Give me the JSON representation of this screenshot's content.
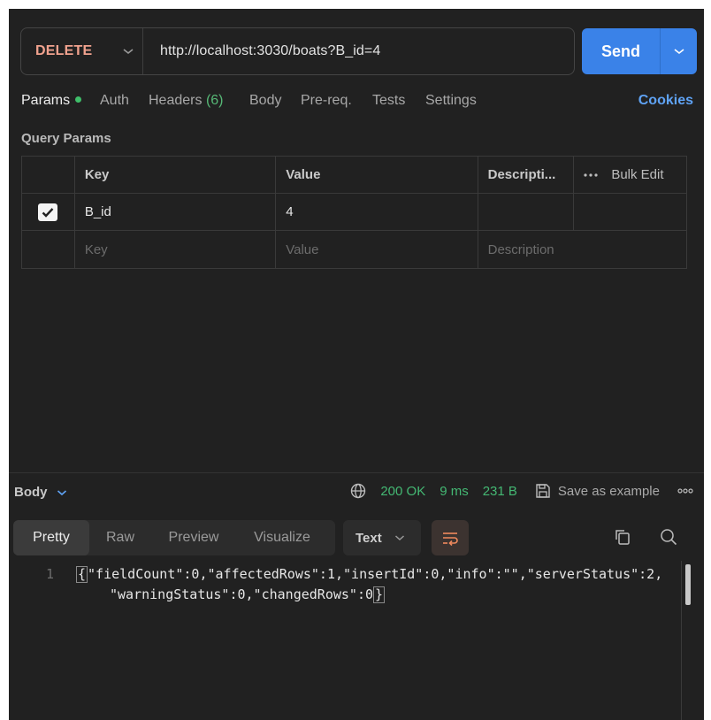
{
  "request": {
    "method": "DELETE",
    "url": "http://localhost:3030/boats?B_id=4",
    "send_label": "Send"
  },
  "tabs": {
    "params": "Params",
    "auth": "Auth",
    "headers": "Headers",
    "headers_count": "(6)",
    "body": "Body",
    "prereq": "Pre-req.",
    "tests": "Tests",
    "settings": "Settings",
    "cookies": "Cookies"
  },
  "query_params": {
    "title": "Query Params",
    "headers": {
      "key": "Key",
      "value": "Value",
      "description": "Descripti...",
      "bulk_edit": "Bulk Edit"
    },
    "rows": [
      {
        "checked": true,
        "key": "B_id",
        "value": "4",
        "description": ""
      }
    ],
    "placeholder": {
      "key": "Key",
      "value": "Value",
      "description": "Description"
    }
  },
  "response": {
    "body_label": "Body",
    "status": "200 OK",
    "time": "9 ms",
    "size": "231 B",
    "save_example": "Save as example",
    "view_tabs": [
      "Pretty",
      "Raw",
      "Preview",
      "Visualize"
    ],
    "active_view": "Pretty",
    "format": "Text",
    "line_number": "1",
    "line1": "\"fieldCount\":0,\"affectedRows\":1,\"insertId\":0,\"info\":\"\",\"serverStatus\":2,",
    "line2": "\"warningStatus\":0,\"changedRows\":0",
    "brace_open": "{",
    "brace_close": "}"
  },
  "colors": {
    "method": "#f1a28e",
    "send": "#3a82e8",
    "status_ok": "#44b873",
    "link": "#5fa3f5"
  }
}
